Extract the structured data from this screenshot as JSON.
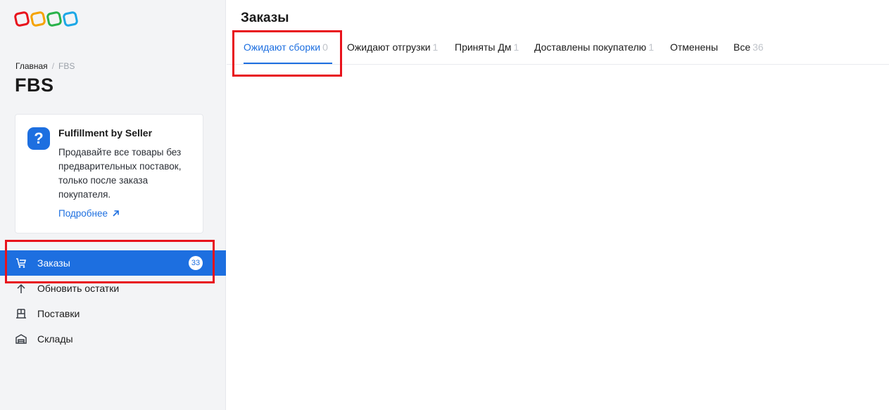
{
  "logo": {
    "colors": [
      "#e8131c",
      "#f5a300",
      "#29b24a",
      "#1ca7e6"
    ]
  },
  "sidebar": {
    "breadcrumb": {
      "home": "Главная",
      "separator": "/",
      "current": "FBS"
    },
    "title": "FBS",
    "info_card": {
      "icon": "question-icon",
      "icon_glyph": "?",
      "title": "Fulfillment by Seller",
      "text": "Продавайте все товары без предварительных поставок, только после заказа покупателя.",
      "link": "Подробнее"
    },
    "nav": [
      {
        "label": "Заказы",
        "icon": "cart-icon",
        "badge": "33",
        "active": true
      },
      {
        "label": "Обновить остатки",
        "icon": "arrow-up-icon"
      },
      {
        "label": "Поставки",
        "icon": "shelf-icon"
      },
      {
        "label": "Склады",
        "icon": "warehouse-icon"
      }
    ]
  },
  "main": {
    "title": "Заказы",
    "tabs": [
      {
        "label": "Ожидают сборки",
        "count": "0",
        "active": true
      },
      {
        "label": "Ожидают отгрузки",
        "count": "1"
      },
      {
        "label": "Приняты Дм",
        "count": "1"
      },
      {
        "label": "Доставлены покупателю",
        "count": "1"
      },
      {
        "label": "Отменены",
        "count": ""
      },
      {
        "label": "Все",
        "count": "36"
      }
    ]
  },
  "colors": {
    "accent": "#1d6fe0",
    "highlight": "#e8131c",
    "sidebar_bg": "#f3f4f6"
  }
}
